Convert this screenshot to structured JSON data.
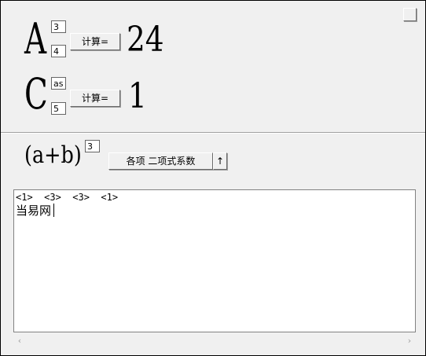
{
  "permutation": {
    "letter": "A",
    "top_value": "3",
    "bottom_value": "4",
    "button_label": "计算=",
    "result": "24"
  },
  "combination": {
    "letter": "C",
    "top_value": "asa",
    "bottom_value": "5",
    "button_label": "计算=",
    "result": "1"
  },
  "binomial": {
    "base_expr": "(a+b)",
    "exponent": "3",
    "mode_label": "各项 二项式系数",
    "arrow_label": "↑"
  },
  "output": {
    "line1": "<1>  <3>  <3>  <1>",
    "line2": "当易网"
  },
  "scrollbar": {
    "left_arrow": "‹",
    "right_arrow": "›"
  }
}
